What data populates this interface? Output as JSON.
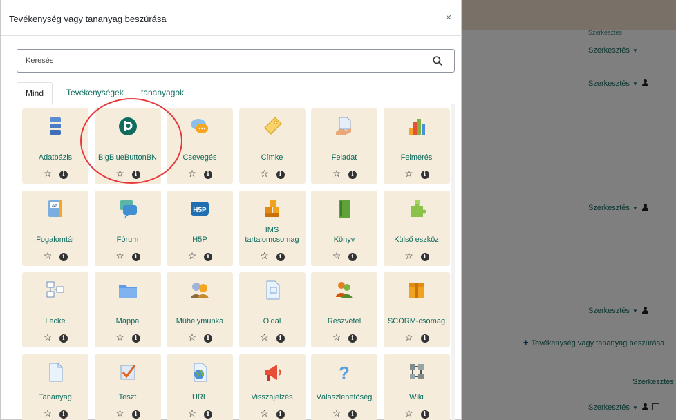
{
  "modal": {
    "title": "Tevékenység vagy tananyag beszúrása",
    "close_glyph": "×"
  },
  "search": {
    "placeholder": "Keresés",
    "value": ""
  },
  "tabs": [
    {
      "label": "Mind",
      "active": true
    },
    {
      "label": "Tevékenységek",
      "active": false
    },
    {
      "label": "tananyagok",
      "active": false
    }
  ],
  "tile_actions": {
    "star": "☆",
    "info": "i"
  },
  "tiles": [
    {
      "label": "Adatbázis",
      "icon": "database-icon"
    },
    {
      "label": "BigBlueButtonBN",
      "icon": "bigbluebutton-icon"
    },
    {
      "label": "Csevegés",
      "icon": "chat-icon"
    },
    {
      "label": "Címke",
      "icon": "label-tag-icon"
    },
    {
      "label": "Feladat",
      "icon": "assignment-icon"
    },
    {
      "label": "Felmérés",
      "icon": "survey-chart-icon"
    },
    {
      "label": "Fogalomtár",
      "icon": "glossary-icon"
    },
    {
      "label": "Fórum",
      "icon": "forum-icon"
    },
    {
      "label": "H5P",
      "icon": "h5p-icon"
    },
    {
      "label": "IMS tartalomcsomag",
      "icon": "ims-package-icon"
    },
    {
      "label": "Könyv",
      "icon": "book-icon"
    },
    {
      "label": "Külső eszköz",
      "icon": "puzzle-icon"
    },
    {
      "label": "Lecke",
      "icon": "lesson-icon"
    },
    {
      "label": "Mappa",
      "icon": "folder-icon"
    },
    {
      "label": "Műhelymunka",
      "icon": "workshop-icon"
    },
    {
      "label": "Oldal",
      "icon": "page-icon"
    },
    {
      "label": "Részvétel",
      "icon": "attendance-icon"
    },
    {
      "label": "SCORM-csomag",
      "icon": "scorm-icon"
    },
    {
      "label": "Tananyag",
      "icon": "file-icon"
    },
    {
      "label": "Teszt",
      "icon": "quiz-icon"
    },
    {
      "label": "URL",
      "icon": "url-globe-icon"
    },
    {
      "label": "Visszajelzés",
      "icon": "feedback-megaphone-icon"
    },
    {
      "label": "Válaszlehetőség",
      "icon": "choice-question-icon"
    },
    {
      "label": "Wiki",
      "icon": "wiki-icon"
    }
  ],
  "background": {
    "edit_label": "Szerkesztés",
    "add_activity_label": "Tevékenység vagy tananyag beszúrása",
    "header_strip_color": "#f3e2cf"
  },
  "colors": {
    "tile_bg": "#f5ecdc",
    "link_green": "#0f6c5e",
    "highlight_ring": "#e8383b"
  }
}
